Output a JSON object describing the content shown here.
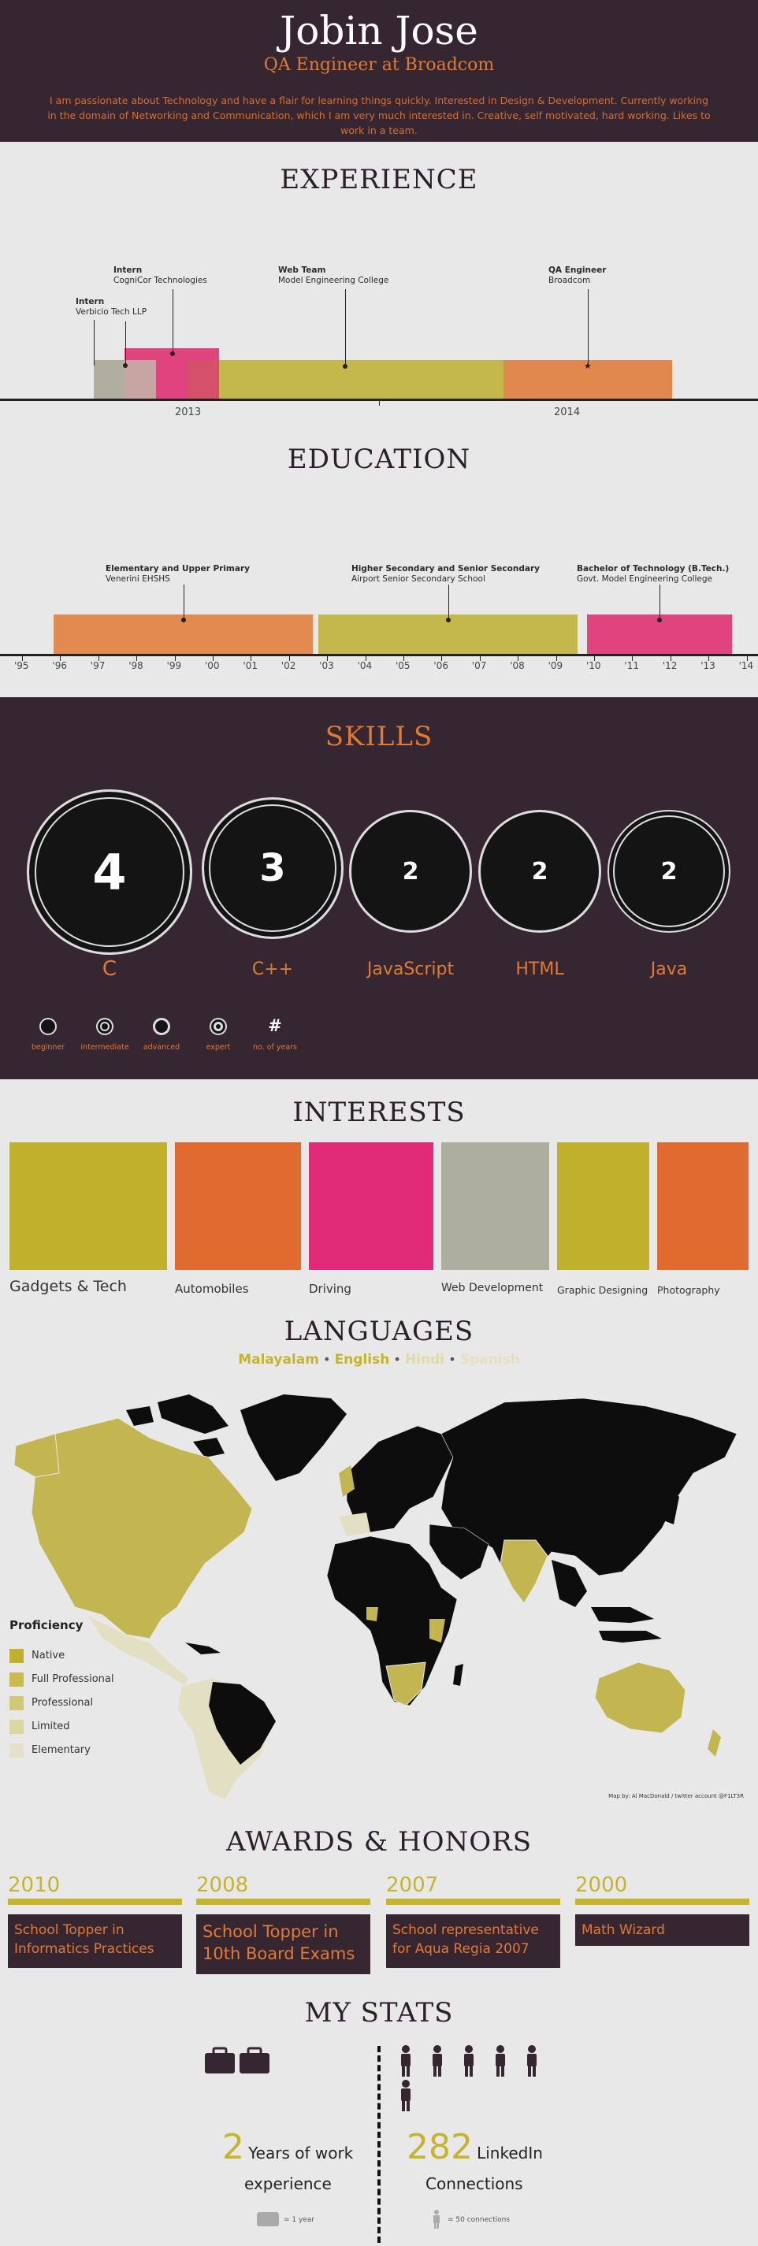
{
  "header": {
    "name": "Jobin Jose",
    "role": "QA Engineer at Broadcom",
    "bio": "I am passionate about Technology and have a flair for learning things quickly. Interested in Design & Development. Currently working in the domain of Networking and Communication, which I am very much interested in. Creative, self motivated, hard working. Likes to work in a team."
  },
  "experience": {
    "title": "EXPERIENCE",
    "entries": [
      {
        "role": "Intern",
        "org": "Verbicio Tech LLP"
      },
      {
        "role": "Intern",
        "org": "CogniCor Technologies"
      },
      {
        "role": "Web Team",
        "org": "Model Engineering College"
      },
      {
        "role": "QA Engineer",
        "org": "Broadcom"
      }
    ],
    "years": [
      "2013",
      "2014"
    ]
  },
  "education": {
    "title": "EDUCATION",
    "entries": [
      {
        "level": "Elementary and Upper Primary",
        "school": "Venerini EHSHS"
      },
      {
        "level": "Higher Secondary and Senior Secondary",
        "school": "Airport Senior Secondary School"
      },
      {
        "level": "Bachelor of Technology (B.Tech.)",
        "school": "Govt. Model Engineering College"
      }
    ],
    "ticks": [
      "'95",
      "'96",
      "'97",
      "'98",
      "'99",
      "'00",
      "'01",
      "'02",
      "'03",
      "'04",
      "'05",
      "'06",
      "'07",
      "'08",
      "'09",
      "'10",
      "'11",
      "'12",
      "'13",
      "'14"
    ]
  },
  "skills": {
    "title": "SKILLS",
    "items": [
      {
        "name": "C",
        "years": "4",
        "level": "expert"
      },
      {
        "name": "C++",
        "years": "3",
        "level": "advanced"
      },
      {
        "name": "JavaScript",
        "years": "2",
        "level": "beginner"
      },
      {
        "name": "HTML",
        "years": "2",
        "level": "beginner"
      },
      {
        "name": "Java",
        "years": "2",
        "level": "intermediate"
      }
    ],
    "legend": [
      "beginner",
      "intermediate",
      "advanced",
      "expert",
      "no. of years"
    ],
    "legend_symbol": "#"
  },
  "interests": {
    "title": "INTERESTS",
    "items": [
      {
        "label": "Gadgets & Tech",
        "color": "#c0b02c"
      },
      {
        "label": "Automobiles",
        "color": "#e06a30"
      },
      {
        "label": "Driving",
        "color": "#e02a78"
      },
      {
        "label": "Web Development",
        "color": "#aeae9e"
      },
      {
        "label": "Graphic Designing",
        "color": "#c0b02c"
      },
      {
        "label": "Photography",
        "color": "#e06a30"
      }
    ]
  },
  "languages": {
    "title": "LANGUAGES",
    "list": [
      {
        "name": "Malayalam",
        "color": "#c5b42c"
      },
      {
        "name": "English",
        "color": "#c5b42c"
      },
      {
        "name": "Hindi",
        "color": "#e0d9a8"
      },
      {
        "name": "Spanish",
        "color": "#e8e0b8"
      }
    ],
    "separator": "•",
    "proficiency_title": "Proficiency",
    "proficiency": [
      {
        "label": "Native",
        "color": "#bfb12c"
      },
      {
        "label": "Full Professional",
        "color": "#c9bb4c"
      },
      {
        "label": "Professional",
        "color": "#d3c878"
      },
      {
        "label": "Limited",
        "color": "#ddd6a3"
      },
      {
        "label": "Elementary",
        "color": "#e6e1c6"
      }
    ],
    "credit": "Map by: Al MacDonald / twitter account @F1LT3R"
  },
  "awards": {
    "title": "AWARDS & HONORS",
    "items": [
      {
        "year": "2010",
        "text": "School Topper in Informatics Practices"
      },
      {
        "year": "2008",
        "text": "School Topper in 10th Board Exams"
      },
      {
        "year": "2007",
        "text": "School representative for Aqua Regia 2007"
      },
      {
        "year": "2000",
        "text": "Math Wizard"
      }
    ]
  },
  "stats": {
    "title": "MY STATS",
    "work_number": "2",
    "work_text_1": "Years of work",
    "work_text_2": "experience",
    "work_legend": "= 1 year",
    "conn_number": "282",
    "conn_text_1": "LinkedIn",
    "conn_text_2": "Connections",
    "conn_legend": "= 50 connections"
  }
}
